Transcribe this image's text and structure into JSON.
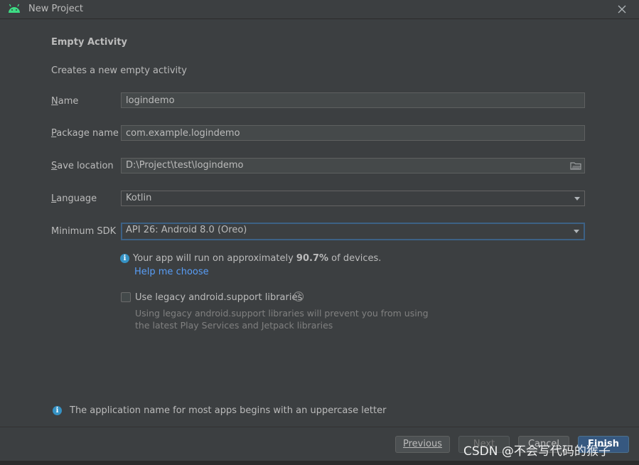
{
  "window": {
    "title": "New Project"
  },
  "heading": "Empty Activity",
  "subtitle": "Creates a new empty activity",
  "form": {
    "name": {
      "label_mnemonic": "N",
      "label_rest": "ame",
      "value": "logindemo"
    },
    "package": {
      "label_mnemonic": "P",
      "label_rest": "ackage name",
      "value": "com.example.logindemo"
    },
    "location": {
      "label_mnemonic": "S",
      "label_rest": "ave location",
      "value": "D:\\Project\\test\\logindemo"
    },
    "language": {
      "label_mnemonic": "L",
      "label_rest": "anguage",
      "value": "Kotlin"
    },
    "min_sdk": {
      "label": "Minimum SDK",
      "value": "API 26: Android 8.0 (Oreo)"
    }
  },
  "sdk_info": {
    "prefix": "Your app will run on approximately ",
    "percent": "90.7%",
    "suffix": " of devices.",
    "help_link": "Help me choose"
  },
  "legacy": {
    "checked": false,
    "label": "Use legacy android.support libraries",
    "desc_line1": "Using legacy android.support libraries will prevent you from using",
    "desc_line2": "the latest Play Services and Jetpack libraries"
  },
  "footer_note": "The application name for most apps begins with an uppercase letter",
  "buttons": {
    "previous": "Previous",
    "next": "Next",
    "cancel": "Cancel",
    "finish": "Finish"
  },
  "watermark": "CSDN @不会写代码的猴子",
  "colors": {
    "accent": "#3592c4",
    "link": "#589df6",
    "primary_button": "#365880",
    "background": "#3c3f41"
  }
}
